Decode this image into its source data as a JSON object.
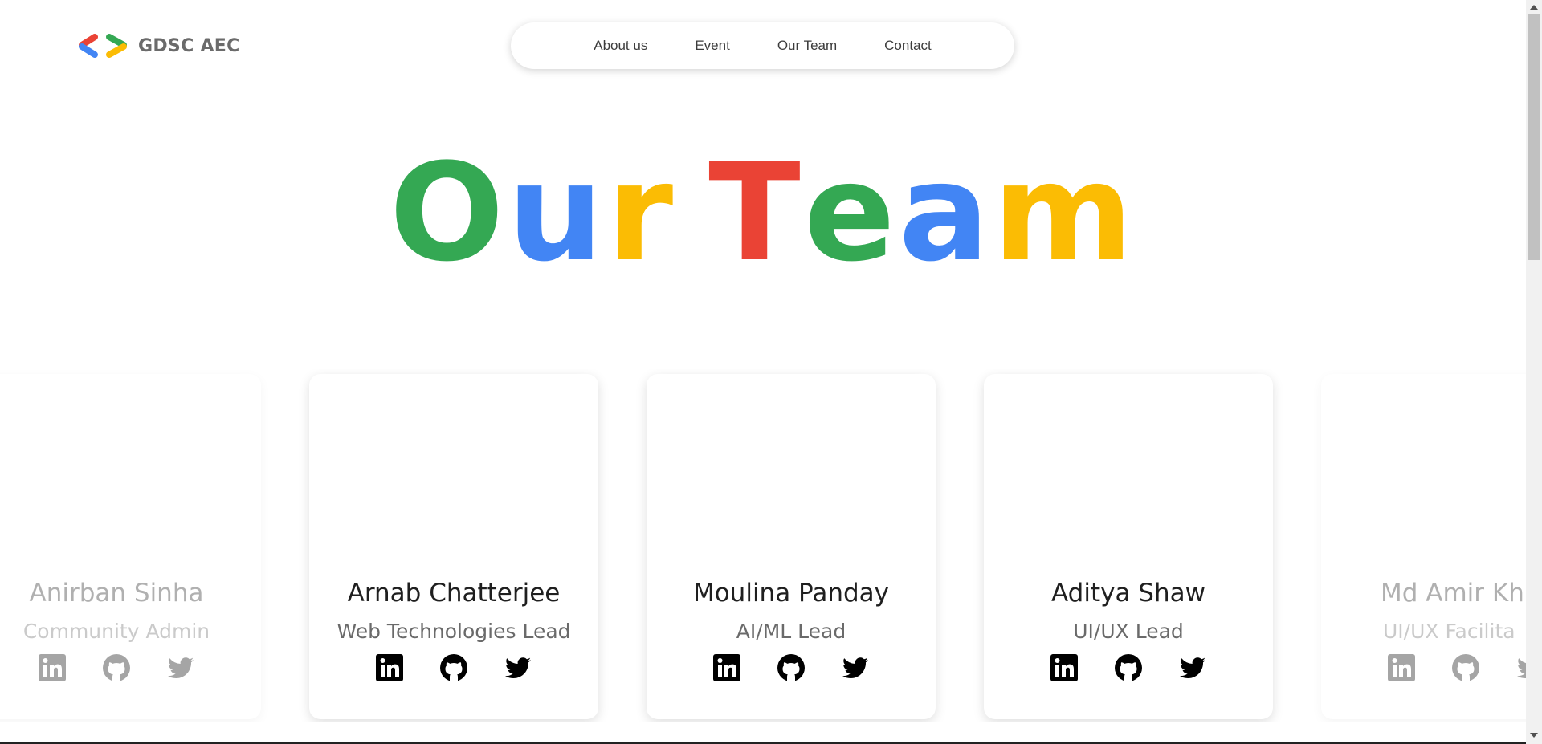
{
  "brand": {
    "name": "GDSC AEC",
    "icon": "gdsc-logo-icon"
  },
  "nav": [
    {
      "label": "About us"
    },
    {
      "label": "Event"
    },
    {
      "label": "Our Team"
    },
    {
      "label": "Contact"
    }
  ],
  "hero": {
    "letters": [
      {
        "ch": "O",
        "color": "#34A853"
      },
      {
        "ch": "u",
        "color": "#4285F4"
      },
      {
        "ch": "r",
        "color": "#FBBC04"
      },
      {
        "ch": "T",
        "color": "#EA4335"
      },
      {
        "ch": "e",
        "color": "#34A853"
      },
      {
        "ch": "a",
        "color": "#4285F4"
      },
      {
        "ch": "m",
        "color": "#FBBC04"
      }
    ]
  },
  "team": [
    {
      "name": "Anirban Sinha",
      "role": "Community Admin",
      "faded": true
    },
    {
      "name": "Arnab Chatterjee",
      "role": "Web Technologies Lead",
      "faded": false
    },
    {
      "name": "Moulina Panday",
      "role": "AI/ML Lead",
      "faded": false
    },
    {
      "name": "Aditya Shaw",
      "role": "UI/UX Lead",
      "faded": false
    },
    {
      "name": "Md Amir Kh",
      "role": "UI/UX Facilita",
      "faded": true
    }
  ],
  "social_icons": [
    "linkedin-icon",
    "github-icon",
    "twitter-icon"
  ]
}
